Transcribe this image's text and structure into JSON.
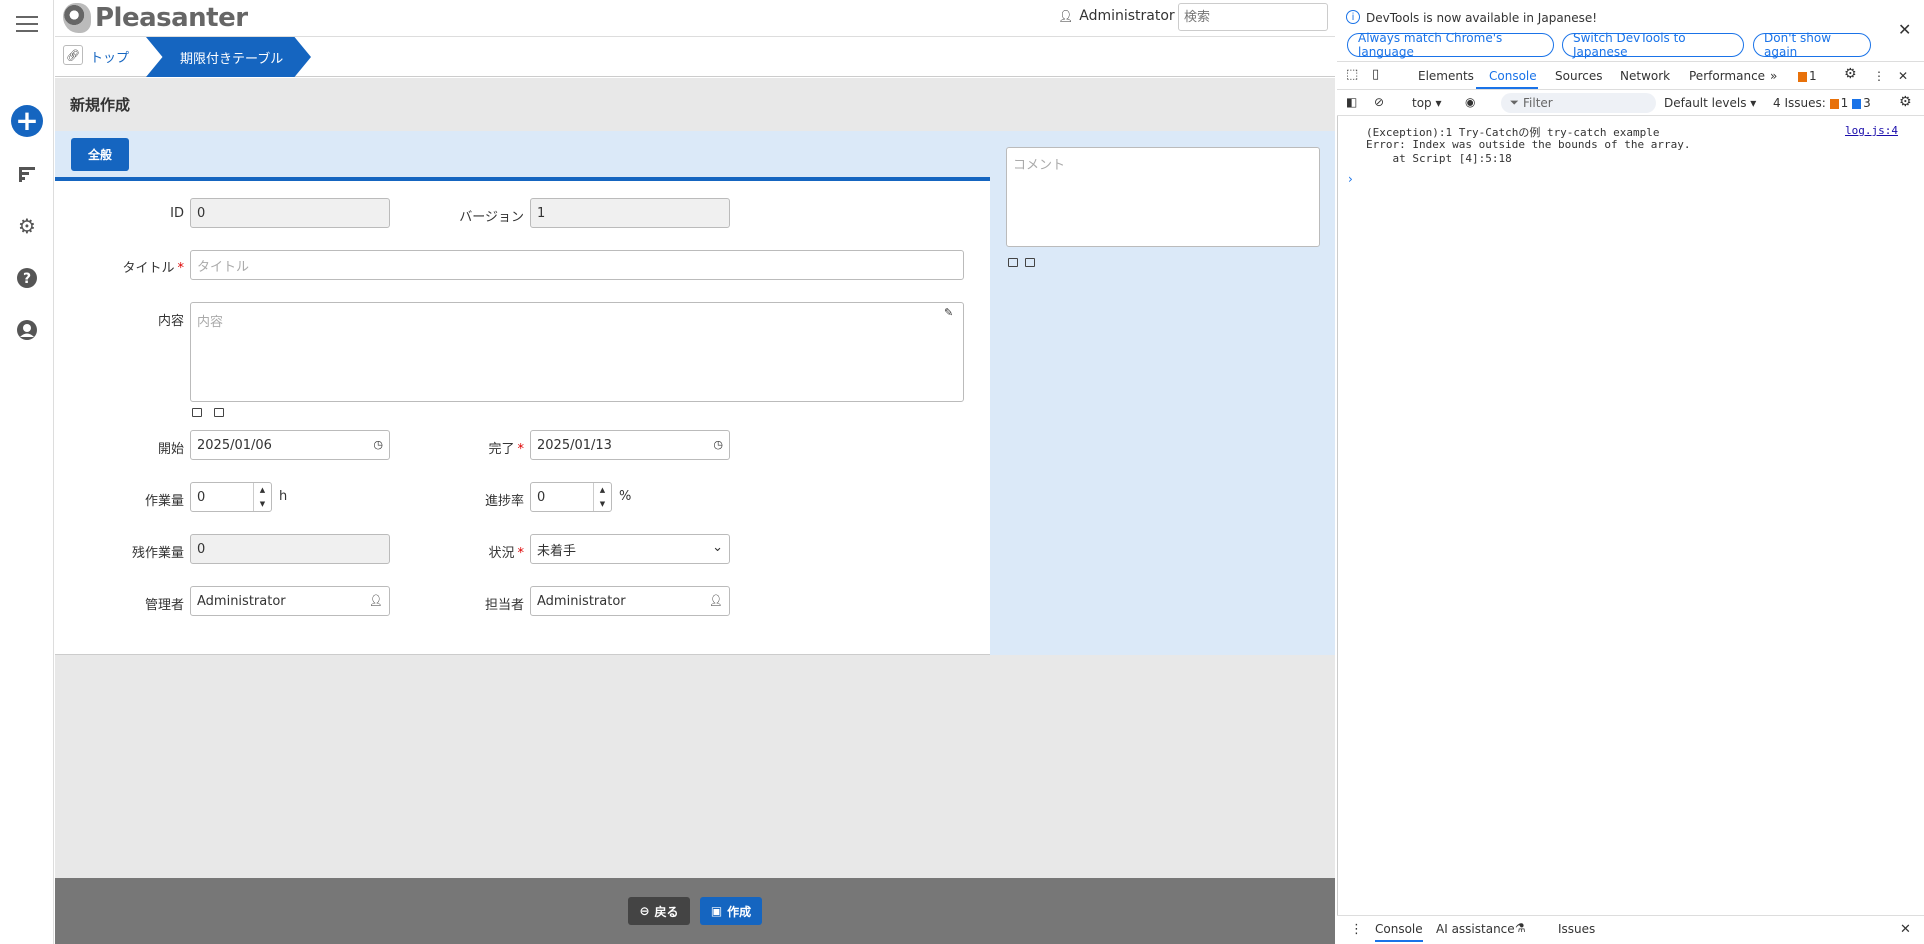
{
  "header": {
    "logo_text": "Pleasanter",
    "user_name": "Administrator",
    "search_placeholder": "検索"
  },
  "breadcrumb": {
    "items": [
      "トップ",
      "期限付きテーブル"
    ]
  },
  "page": {
    "title": "新規作成",
    "tab_general": "全般"
  },
  "form": {
    "id_label": "ID",
    "id_value": "0",
    "version_label": "バージョン",
    "version_value": "1",
    "title_label": "タイトル",
    "title_placeholder": "タイトル",
    "body_label": "内容",
    "body_placeholder": "内容",
    "start_label": "開始",
    "start_value": "2025/01/06",
    "complete_label": "完了",
    "complete_value": "2025/01/13",
    "workvalue_label": "作業量",
    "workvalue_value": "0",
    "workvalue_unit": "h",
    "progress_label": "進捗率",
    "progress_value": "0",
    "progress_unit": "%",
    "remaining_label": "残作業量",
    "remaining_value": "0",
    "status_label": "状況",
    "status_value": "未着手",
    "manager_label": "管理者",
    "manager_value": "Administrator",
    "owner_label": "担当者",
    "owner_value": "Administrator",
    "required_mark": "*"
  },
  "comment": {
    "placeholder": "コメント"
  },
  "footer": {
    "back_label": "戻る",
    "create_label": "作成"
  },
  "devtools": {
    "info_text": "DevTools is now available in Japanese!",
    "btn_match": "Always match Chrome's language",
    "btn_switch": "Switch DevTools to Japanese",
    "btn_dont": "Don't show again",
    "tabs": [
      "Elements",
      "Console",
      "Sources",
      "Network",
      "Performance"
    ],
    "warn_count": "1",
    "context": "top",
    "filter_placeholder": "Filter",
    "levels": "Default levels",
    "issues_label": "4 Issues:",
    "issues_warn": "1",
    "issues_info": "3",
    "log_line1": "(Exception):1 Try-Catchの例 try-catch example",
    "log_line2": "Error: Index was outside the bounds of the array.",
    "log_line3": "    at Script [4]:5:18",
    "log_source": "log.js:4",
    "bottom_tabs": [
      "Console",
      "AI assistance",
      "Issues"
    ]
  },
  "colors": {
    "accent": "#1565c0",
    "panel_bg": "#dbe9f8",
    "footer_bg": "#777777"
  }
}
